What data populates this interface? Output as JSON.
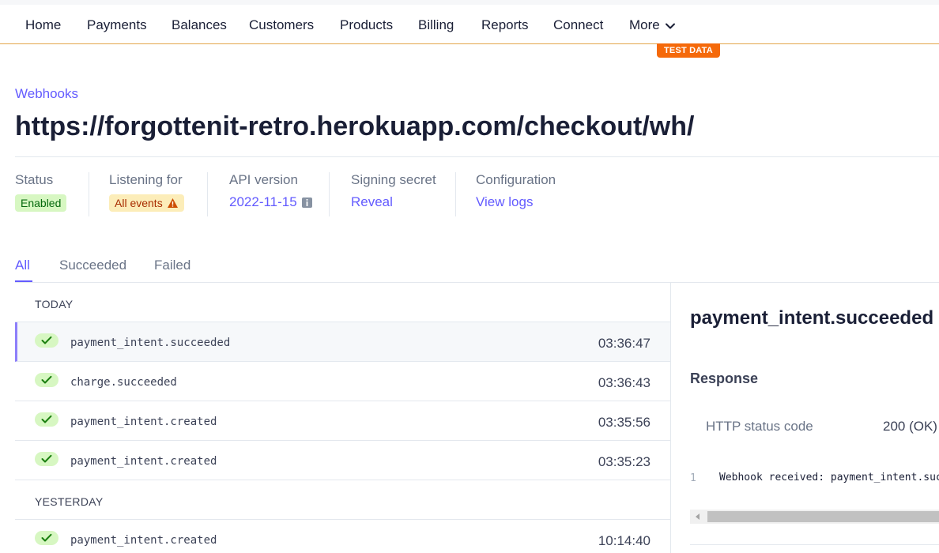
{
  "nav": {
    "items": [
      "Home",
      "Payments",
      "Balances",
      "Customers",
      "Products",
      "Billing",
      "Reports",
      "Connect"
    ],
    "more_label": "More",
    "test_badge": "TEST DATA"
  },
  "header": {
    "breadcrumb": "Webhooks",
    "title": "https://forgottenit-retro.herokuapp.com/checkout/wh/"
  },
  "meta": {
    "status_label": "Status",
    "status_value": "Enabled",
    "listening_label": "Listening for",
    "listening_value": "All events",
    "api_label": "API version",
    "api_value": "2022-11-15",
    "secret_label": "Signing secret",
    "secret_value": "Reveal",
    "config_label": "Configuration",
    "config_value": "View logs"
  },
  "tabs": [
    "All",
    "Succeeded",
    "Failed"
  ],
  "events": {
    "today_label": "TODAY",
    "yesterday_label": "YESTERDAY",
    "today": [
      {
        "name": "payment_intent.succeeded",
        "time": "03:36:47",
        "status": "succeeded"
      },
      {
        "name": "charge.succeeded",
        "time": "03:36:43",
        "status": "succeeded"
      },
      {
        "name": "payment_intent.created",
        "time": "03:35:56",
        "status": "succeeded"
      },
      {
        "name": "payment_intent.created",
        "time": "03:35:23",
        "status": "succeeded"
      }
    ],
    "yesterday": [
      {
        "name": "payment_intent.created",
        "time": "10:14:40",
        "status": "succeeded"
      }
    ]
  },
  "detail": {
    "title": "payment_intent.succeeded",
    "response_label": "Response",
    "http_label": "HTTP status code",
    "http_value": "200 (OK)",
    "code_line_no": "1",
    "code_line": "Webhook received: payment_intent.succeeded"
  },
  "colors": {
    "accent": "#635bff",
    "success_bg": "#d7f7c2",
    "test_badge": "#f5690a"
  }
}
